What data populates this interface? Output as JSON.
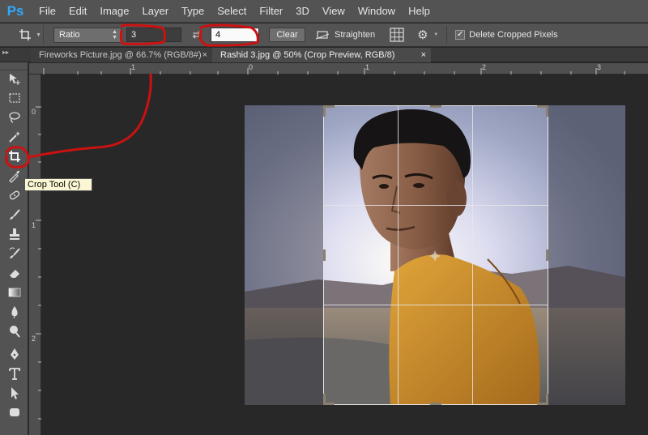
{
  "app": {
    "logo": "Ps"
  },
  "menu": [
    "File",
    "Edit",
    "Image",
    "Layer",
    "Type",
    "Select",
    "Filter",
    "3D",
    "View",
    "Window",
    "Help"
  ],
  "options": {
    "preset_select": "Ratio",
    "ratio_width": "3",
    "ratio_height": "4",
    "clear_label": "Clear",
    "straighten_label": "Straighten",
    "delete_cropped_label": "Delete Cropped Pixels",
    "delete_cropped_checked": true
  },
  "tabs": [
    {
      "label": "Fireworks Picture.jpg @ 66.7% (RGB/8#)",
      "close": "×",
      "active": false
    },
    {
      "label": "Rashid 3.jpg @ 50% (Crop Preview, RGB/8)",
      "close": "×",
      "active": true
    }
  ],
  "ruler_top": [
    "1",
    "0",
    "1",
    "2",
    "3"
  ],
  "ruler_left": [
    "0",
    "1",
    "2"
  ],
  "tooltip": "Crop Tool (C)",
  "tools": [
    "move-icon",
    "marquee-icon",
    "lasso-icon",
    "magic-wand-icon",
    "crop-icon",
    "eyedropper-icon",
    "healing-brush-icon",
    "brush-icon",
    "clone-stamp-icon",
    "history-brush-icon",
    "eraser-icon",
    "gradient-icon",
    "blur-icon",
    "dodge-icon",
    "pen-icon",
    "type-icon",
    "path-selection-icon",
    "shape-icon"
  ],
  "colors": {
    "panel": "#535353",
    "canvas": "#282828",
    "annotation": "#cc1111",
    "tooltip_bg": "#fbf7d4"
  }
}
